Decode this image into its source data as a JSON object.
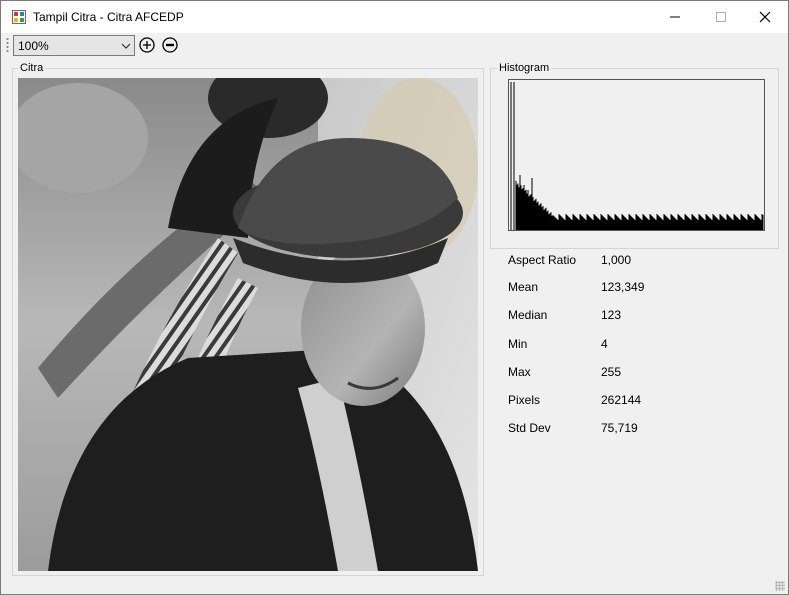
{
  "window": {
    "title": "Tampil Citra - Citra AFCEDP"
  },
  "toolbar": {
    "zoom_value": "100%",
    "zoom_in_icon": "plus-circle-icon",
    "zoom_out_icon": "minus-circle-icon"
  },
  "image_panel": {
    "label": "Citra"
  },
  "histogram_panel": {
    "label": "Histogram"
  },
  "stats": [
    {
      "label": "Aspect Ratio",
      "value": "1,000"
    },
    {
      "label": "Mean",
      "value": "123,349"
    },
    {
      "label": "Median",
      "value": "123"
    },
    {
      "label": "Min",
      "value": "4"
    },
    {
      "label": "Max",
      "value": "255"
    },
    {
      "label": "Pixels",
      "value": "262144"
    },
    {
      "label": "Std Dev",
      "value": "75,719"
    }
  ]
}
